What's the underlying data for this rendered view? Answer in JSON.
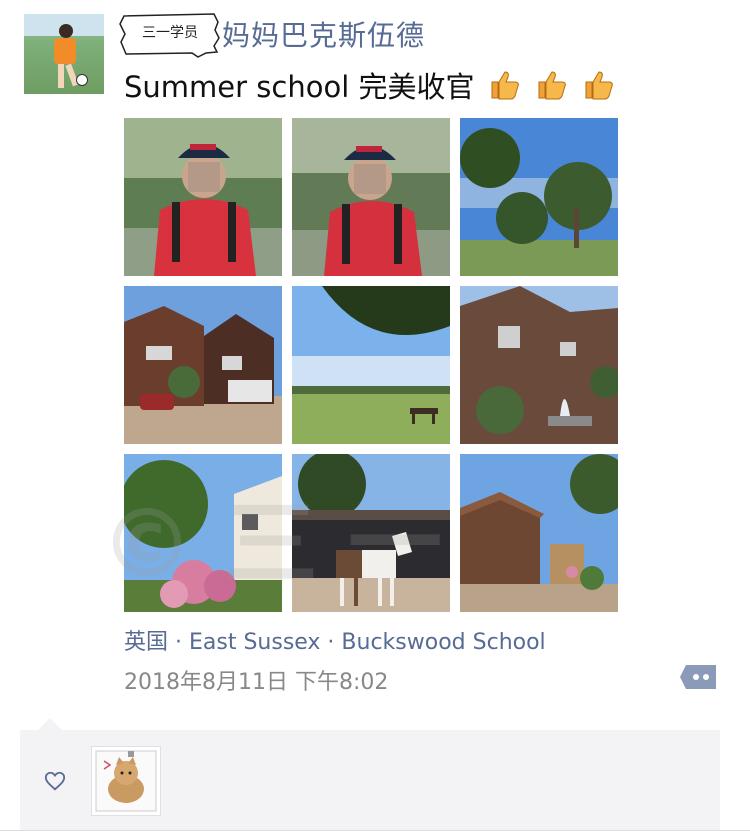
{
  "post": {
    "badge": "三一学员",
    "nickname": "妈妈巴克斯伍德",
    "text": "Summer school 完美收官",
    "thumbs_icons": [
      "thumbs-up-icon",
      "thumbs-up-icon",
      "thumbs-up-icon"
    ],
    "photos": [
      {
        "name": "photo-boy-cap-1"
      },
      {
        "name": "photo-boy-cap-2"
      },
      {
        "name": "photo-trees-sky"
      },
      {
        "name": "photo-brick-house-car"
      },
      {
        "name": "photo-field-bench"
      },
      {
        "name": "photo-old-house-fountain"
      },
      {
        "name": "photo-garden-flowers"
      },
      {
        "name": "photo-pony-stable"
      },
      {
        "name": "photo-yard-cottage"
      }
    ],
    "location": "英国 · East Sussex · Buckswood School",
    "timestamp": "2018年8月11日 下午8:02"
  },
  "colors": {
    "link": "#576b95",
    "meta": "#888888",
    "comment_bg": "#f3f3f5"
  }
}
